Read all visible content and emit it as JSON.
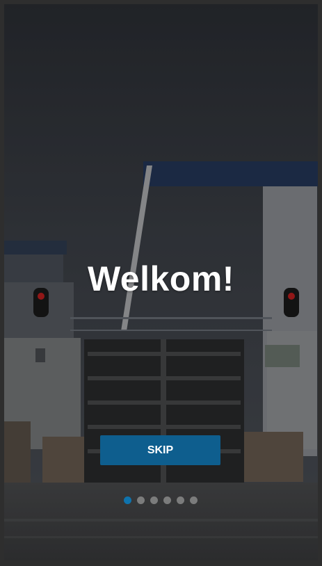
{
  "welcome": {
    "title": "Welkom!",
    "skip_label": "SKIP",
    "page_indicator": {
      "total": 6,
      "active_index": 0
    }
  },
  "colors": {
    "accent": "#0e5e8e",
    "dot_active": "#0f73ad",
    "dot_inactive": "#9a9a9a"
  }
}
